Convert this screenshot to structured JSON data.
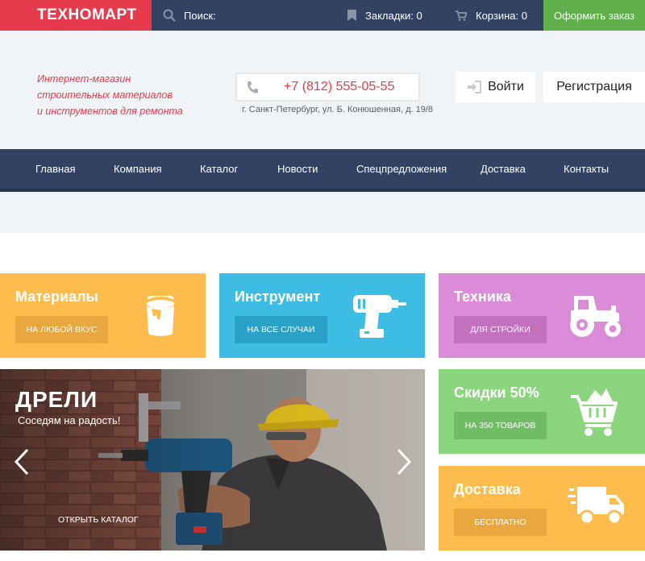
{
  "topbar": {
    "logo": "ТЕХНОМАРТ",
    "search_label": "Поиск:",
    "bookmarks_label": "Закладки: 0",
    "cart_label": "Корзина: 0",
    "order_button": "Оформить заказ",
    "icons": [
      "search-icon",
      "bookmark-icon",
      "cart-icon"
    ]
  },
  "header": {
    "tagline": [
      "Интернет-магазин",
      "строительных материалов",
      "и инструментов для ремонта"
    ],
    "phone": "+7 (812) 555-05-55",
    "address": "г. Санкт-Петербург, ул. Б. Конюшенная, д. 19/8",
    "login_button": "Войти",
    "register_button": "Регистрация",
    "icons": [
      "phone-icon",
      "login-icon"
    ]
  },
  "nav": {
    "items": [
      "Главная",
      "Компания",
      "Каталог",
      "Новости",
      "Спецпредложения",
      "Доставка",
      "Контакты"
    ]
  },
  "tiles": {
    "materials": {
      "title": "Материалы",
      "button": "На любой вкус",
      "icon": "paint-bucket-icon",
      "color": "#fdbc4b"
    },
    "tools": {
      "title": "Инструмент",
      "button": "На все случаи",
      "icon": "drill-icon",
      "color": "#3dbde3"
    },
    "machinery": {
      "title": "Техника",
      "button": "Для стройки",
      "icon": "tractor-icon",
      "color": "#db8cd8"
    },
    "discount": {
      "title": "Скидки 50%",
      "button": "На 350 товаров",
      "icon": "shopping-cart-icon",
      "color": "#8bd57f"
    },
    "delivery": {
      "title": "Доставка",
      "button": "Бесплатно",
      "icon": "delivery-truck-icon",
      "color": "#fdbc4b"
    }
  },
  "hero": {
    "title": "ДРЕЛИ",
    "subtitle": "Соседям на радость!",
    "link": "Открыть каталог",
    "icons": [
      "arrow-left-icon",
      "arrow-right-icon"
    ]
  },
  "colors": {
    "brand_red": "#e83a4d",
    "navy": "#334263",
    "green": "#60b04b",
    "header_bg": "#f1f4f6"
  }
}
